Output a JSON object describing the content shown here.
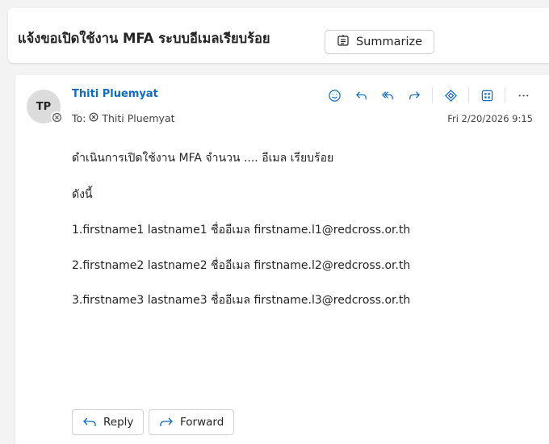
{
  "header": {
    "subject": "แจ้งขอเปิดใช้งาน MFA ระบบอีเมลเรียบร้อย",
    "summarize_label": "Summarize"
  },
  "message": {
    "avatar_initials": "TP",
    "sender_name": "Thiti Pluemyat",
    "to_label": "To:",
    "to_name": "Thiti Pluemyat",
    "date": "Fri 2/20/2026 9:15",
    "body_lines": [
      "ดำเนินการเปิดใช้งาน MFA จำนวน .... อีเมล เรียบร้อย",
      "ดังนี้",
      "1.firstname1 lastname1 ชื่ออีเมล firstname.l1@redcross.or.th",
      "2.firstname2 lastname2 ชื่ออีเมล firstname.l2@redcross.or.th",
      "3.firstname3 lastname3 ชื่ออีเมล firstname.l3@redcross.or.th"
    ],
    "reply_label": "Reply",
    "forward_label": "Forward"
  },
  "icons": {
    "actions": [
      "emoji-icon",
      "reply-icon",
      "reply-all-icon",
      "forward-icon",
      "copilot-icon",
      "apps-icon",
      "more-icon"
    ],
    "accent_color": "#0f6cbd"
  }
}
